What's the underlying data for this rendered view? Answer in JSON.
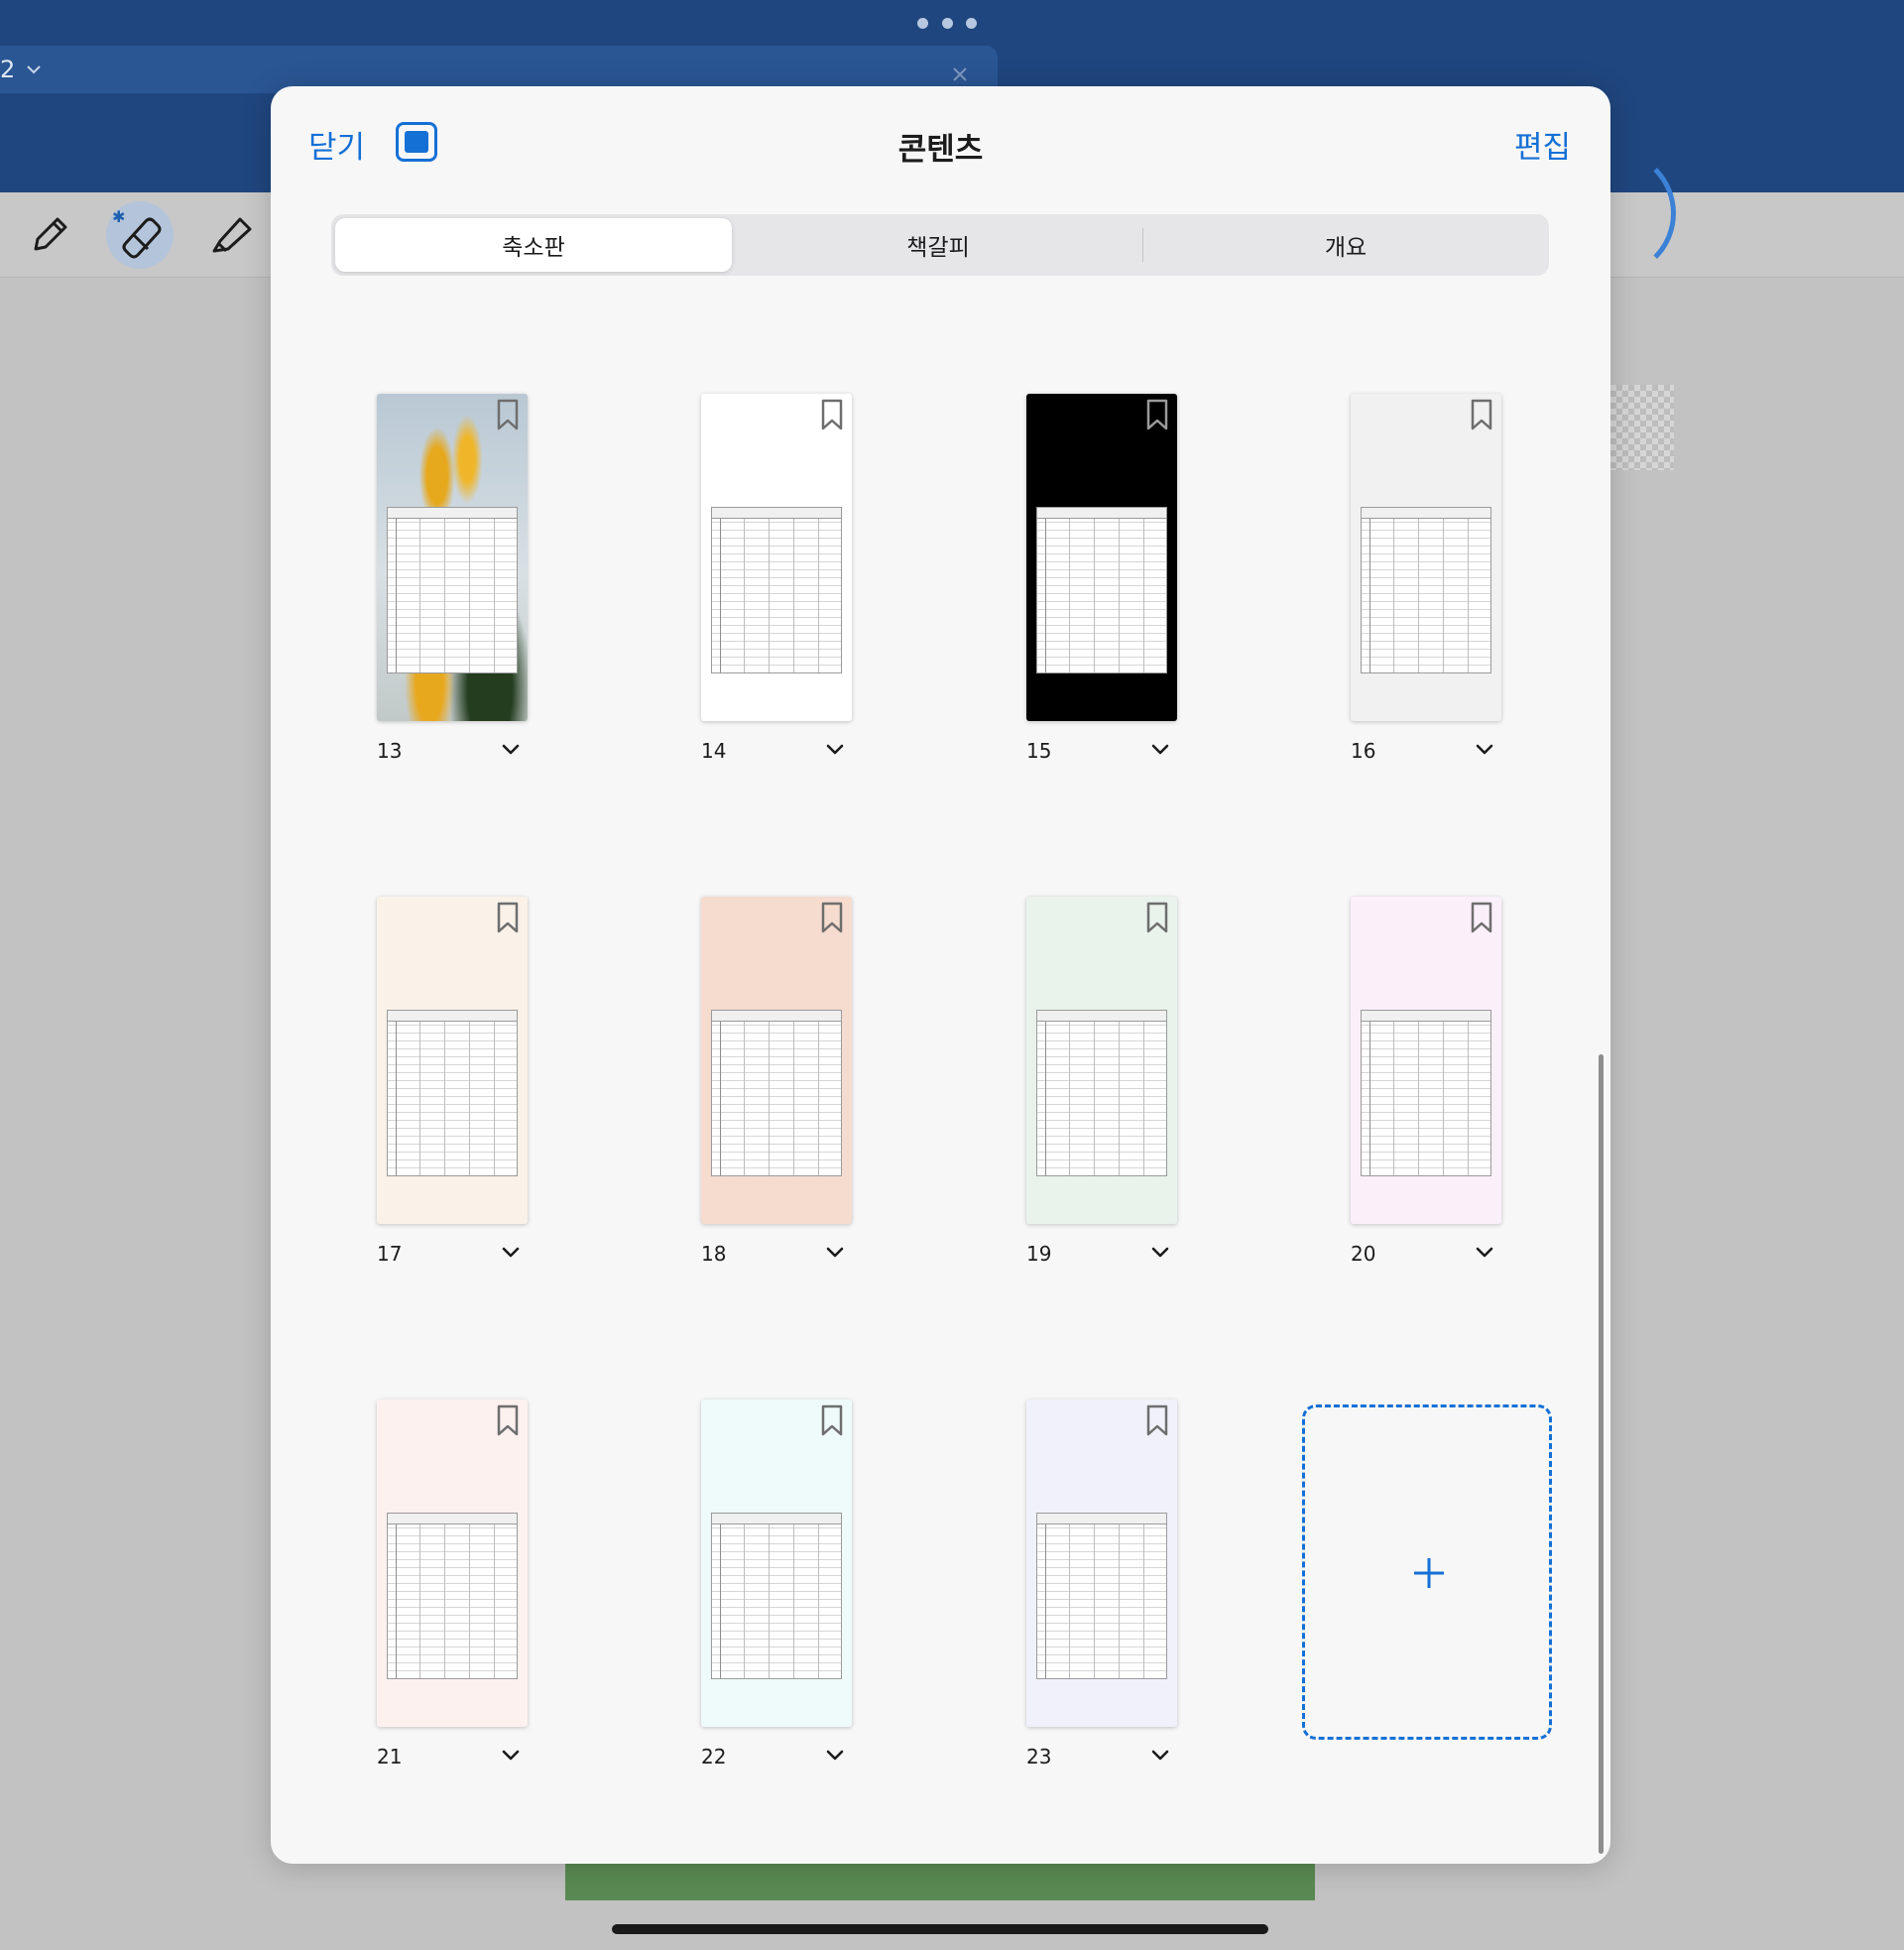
{
  "background_app": {
    "tab_title": "2",
    "tools": [
      {
        "name": "pen-tool",
        "icon": "pencil-icon"
      },
      {
        "name": "eraser-tool",
        "icon": "eraser-icon",
        "active": true
      },
      {
        "name": "highlighter-tool",
        "icon": "highlighter-icon"
      }
    ],
    "bluetooth_badge": "✱"
  },
  "modal": {
    "close_label": "닫기",
    "title": "콘텐츠",
    "edit_label": "편집",
    "segments": [
      "축소판",
      "책갈피",
      "개요"
    ],
    "active_segment": 0,
    "pages": [
      {
        "label": "13",
        "background": "photo"
      },
      {
        "label": "14",
        "background": "#ffffff"
      },
      {
        "label": "15",
        "background": "#000000"
      },
      {
        "label": "16",
        "background": "#f1f1f1"
      },
      {
        "label": "17",
        "background": "#faf1e8"
      },
      {
        "label": "18",
        "background": "#f5dccf"
      },
      {
        "label": "19",
        "background": "#eaf2ec"
      },
      {
        "label": "20",
        "background": "#faf0fa"
      },
      {
        "label": "21",
        "background": "#fdf1ef"
      },
      {
        "label": "22",
        "background": "#effafa"
      },
      {
        "label": "23",
        "background": "#f1f1fb"
      }
    ],
    "add_page_symbol": "+",
    "accent_color": "#1570d6"
  }
}
